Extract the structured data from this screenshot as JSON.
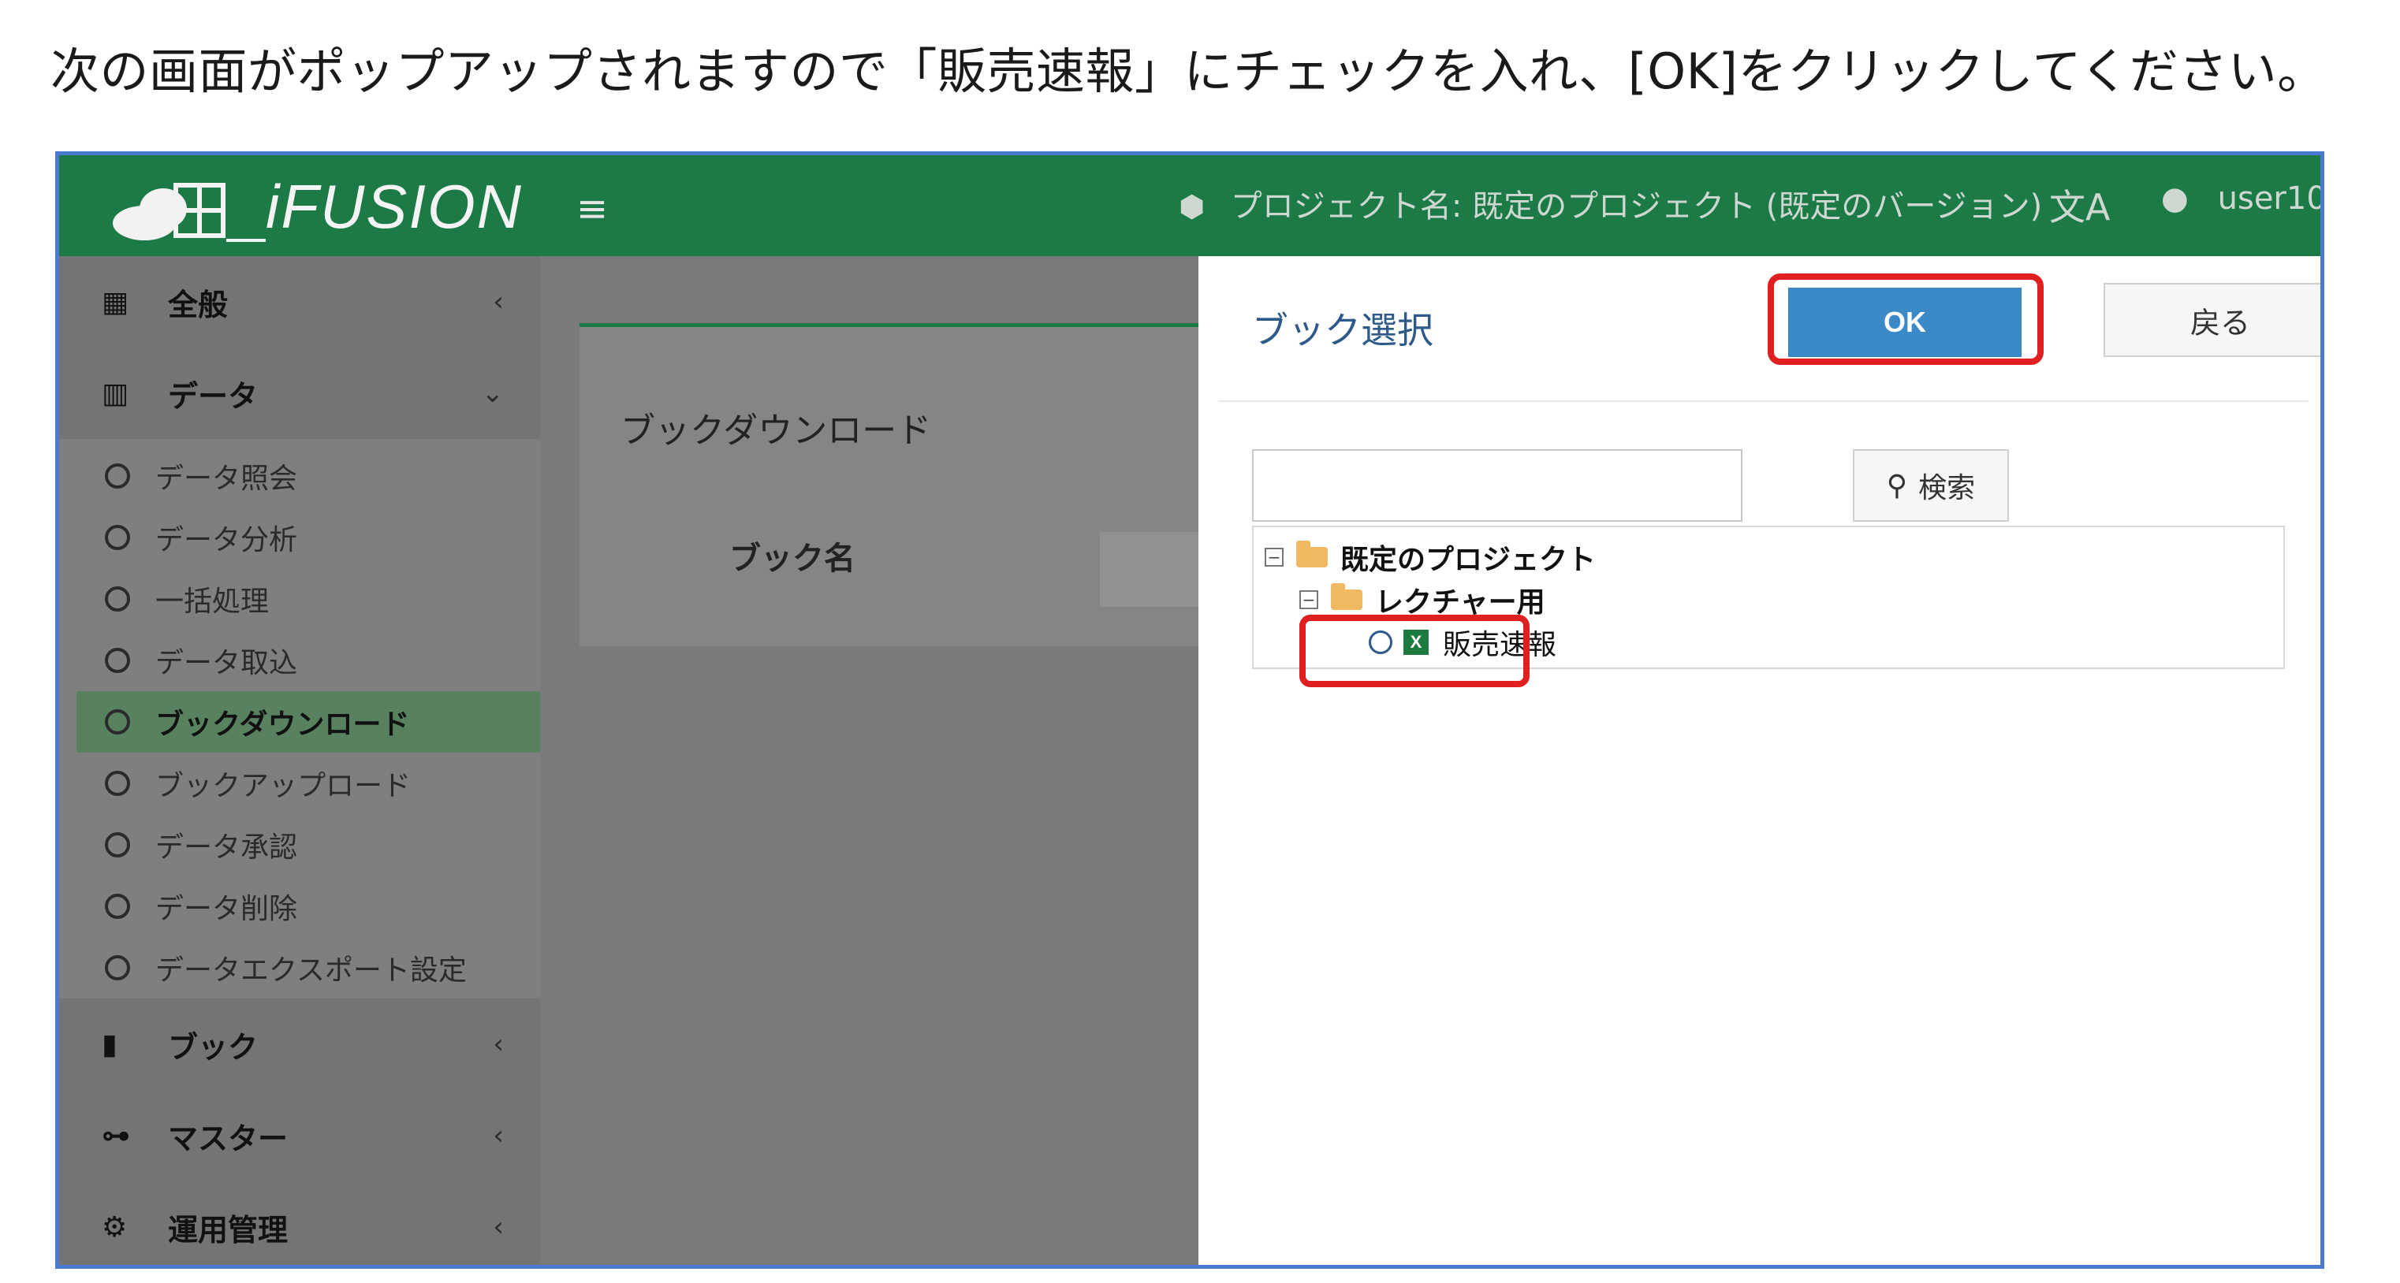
{
  "instruction": "次の画面がポップアップされますので「販売速報」にチェックを入れ、[OK]をクリックしてください。",
  "colors": {
    "header": "#1c7a46",
    "highlight": "#e02020",
    "ok_button": "#3b8ac7",
    "active_item": "#58825f"
  },
  "header": {
    "logo": "iFUSION",
    "project": "プロジェクト名: 既定のプロジェクト (既定のバージョン)",
    "user": "user10"
  },
  "sidebar": {
    "sections": {
      "general": "全般",
      "data": "データ",
      "book": "ブック",
      "master": "マスター",
      "admin": "運用管理"
    },
    "data_items": [
      "データ照会",
      "データ分析",
      "一括処理",
      "データ取込",
      "ブックダウンロード",
      "ブックアップロード",
      "データ承認",
      "データ削除",
      "データエクスポート設定"
    ]
  },
  "content": {
    "title": "ブックダウンロード",
    "book_name_label": "ブック名"
  },
  "dialog": {
    "title": "ブック選択",
    "ok": "OK",
    "back": "戻る",
    "search": "検索",
    "tree": {
      "root": "既定のプロジェクト",
      "folder": "レクチャー用",
      "file": "販売速報"
    }
  }
}
